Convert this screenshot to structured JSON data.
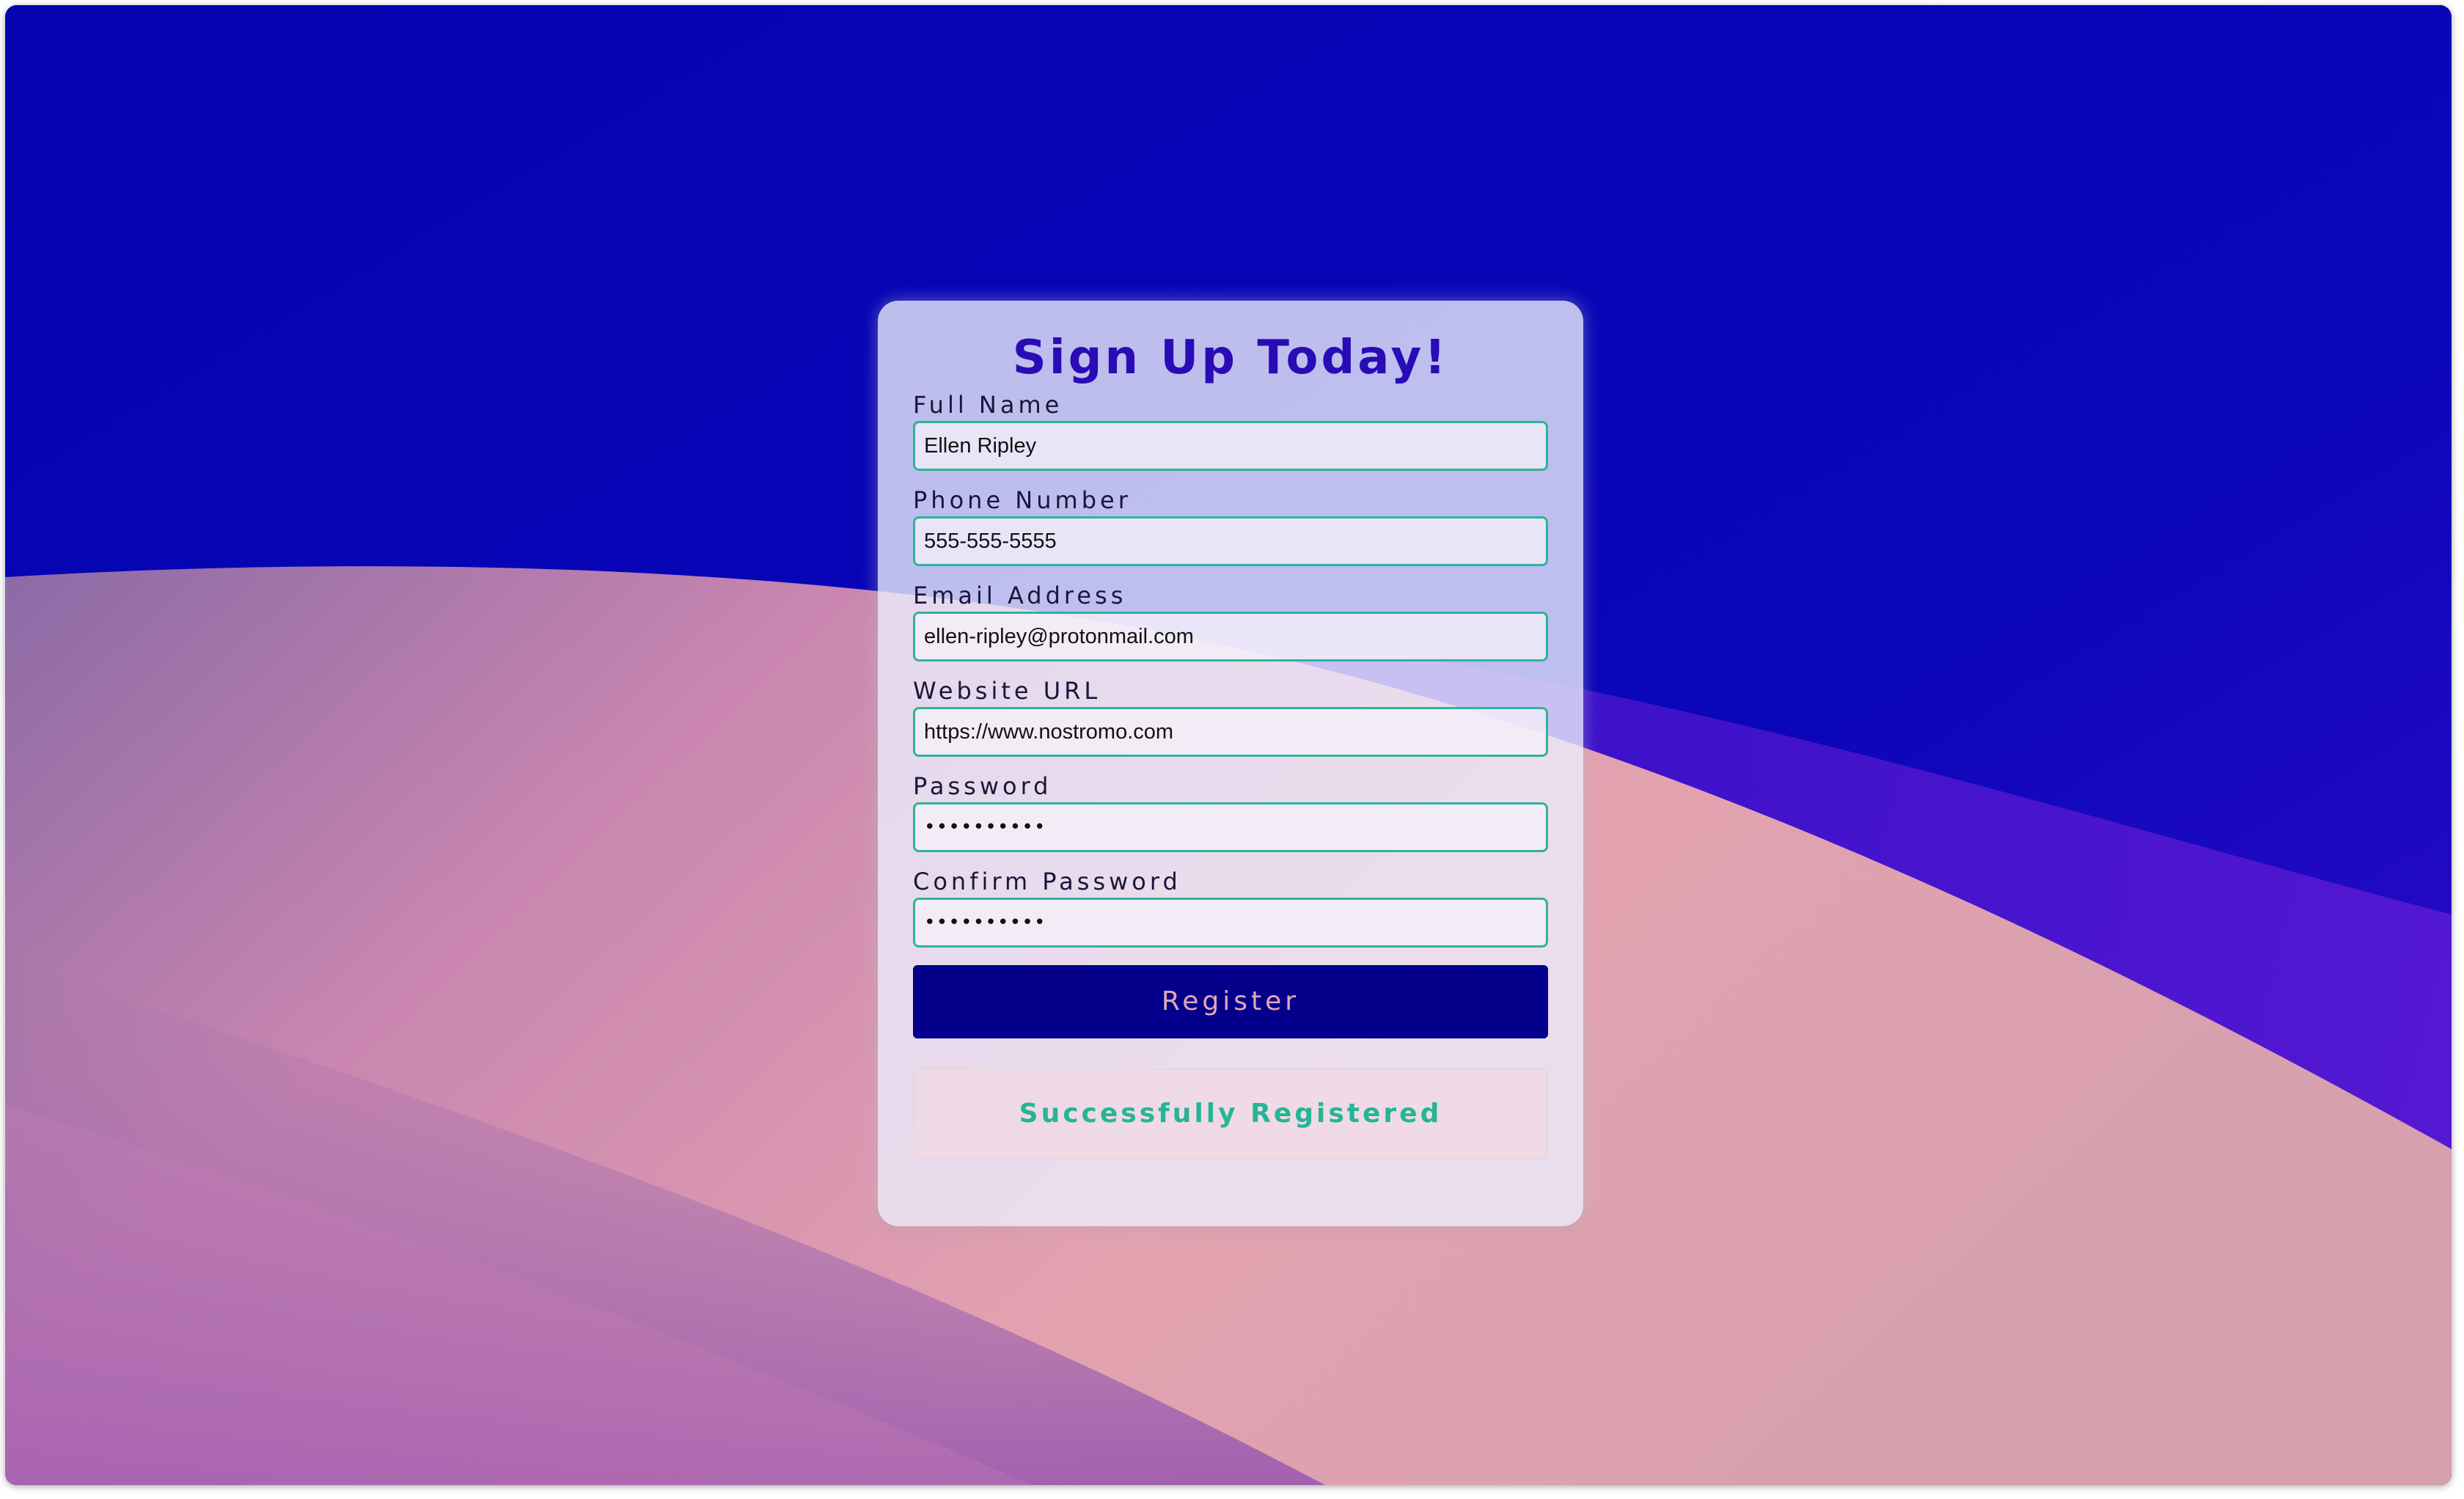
{
  "form": {
    "title": "Sign Up Today!",
    "fields": [
      {
        "label": "Full Name",
        "value": "Ellen Ripley"
      },
      {
        "label": "Phone Number",
        "value": "555-555-5555"
      },
      {
        "label": "Email Address",
        "value": "ellen-ripley@protonmail.com"
      },
      {
        "label": "Website URL",
        "value": "https://www.nostromo.com"
      },
      {
        "label": "Password",
        "value": "••••••••••"
      },
      {
        "label": "Confirm Password",
        "value": "••••••••••"
      }
    ],
    "register_label": "Register",
    "status_message": "Successfully Registered"
  },
  "colors": {
    "title": "#2a0cb6",
    "input_border": "#2fb39a",
    "button_bg": "#04008c",
    "button_text": "#e3a8b4",
    "success_text": "#25b596",
    "background_top": "#0505b5",
    "background_wave": "#e3a2b0"
  }
}
